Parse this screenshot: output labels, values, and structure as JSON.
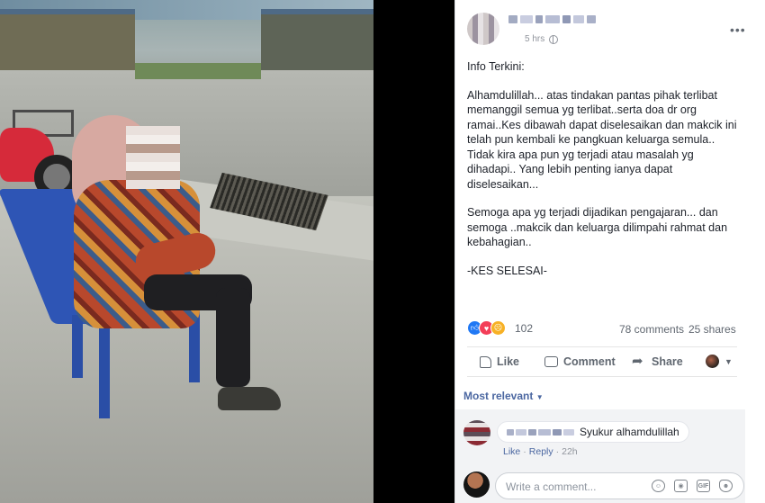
{
  "post": {
    "time": "5 hrs",
    "paragraphs": [
      "Info Terkini:",
      "Alhamdulillah... atas tindakan pantas pihak terlibat memanggil semua yg terlibat..serta doa dr org ramai..Kes dibawah dapat diselesaikan dan makcik ini telah pun kembali ke pangkuan keluarga semula.. Tidak kira apa pun yg terjadi atau masalah yg dihadapi.. Yang lebih penting ianya dapat diselesaikan...",
      "Semoga apa yg terjadi dijadikan pengajaran... dan semoga ..makcik dan keluarga dilimpahi rahmat dan kebahagian..",
      "-KES SELESAI-"
    ]
  },
  "stats": {
    "reaction_count": "102",
    "comments": "78 comments",
    "shares": "25 shares"
  },
  "actions": {
    "like": "Like",
    "comment": "Comment",
    "share": "Share"
  },
  "comments": {
    "sort_label": "Most relevant",
    "items": [
      {
        "text": "Syukur alhamdulillah",
        "like": "Like",
        "reply": "Reply",
        "time": "22h"
      }
    ],
    "write_placeholder": "Write a comment...",
    "composer_icons": [
      "emoji-icon",
      "camera-icon",
      "gif-icon",
      "sticker-icon"
    ]
  },
  "colors": {
    "link": "#4b67a1",
    "like_react": "#2078f4",
    "love_react": "#f33e58",
    "sad_react": "#f7b125"
  }
}
